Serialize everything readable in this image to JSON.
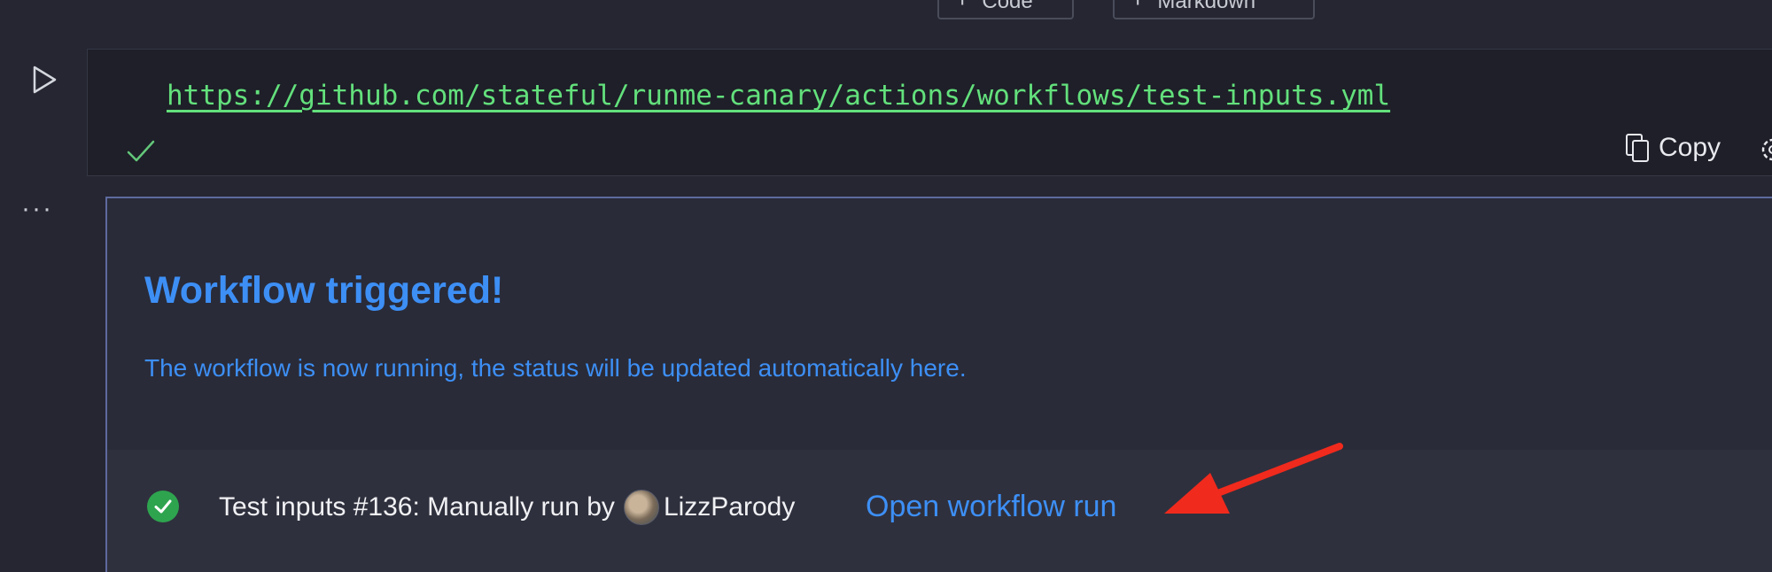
{
  "toolbar": {
    "code_label": "Code",
    "markdown_label": "Markdown"
  },
  "cell": {
    "url": "https://github.com/stateful/runme-canary/actions/workflows/test-inputs.yml",
    "copy_label": "Copy",
    "status_icon": "check-icon"
  },
  "output": {
    "title": "Workflow triggered!",
    "description": "The workflow is now running, the status will be updated automatically here.",
    "run": {
      "status": "success",
      "text_prefix": "Test inputs #136: Manually run by",
      "user": "LizzParody",
      "link_label": "Open workflow run"
    }
  },
  "colors": {
    "background": "#252632",
    "code_bg": "#1e1f28",
    "url_green": "#63e07c",
    "link_blue": "#3d8ff5",
    "success_green": "#2ea44f",
    "annotation_red": "#f02a1d"
  }
}
